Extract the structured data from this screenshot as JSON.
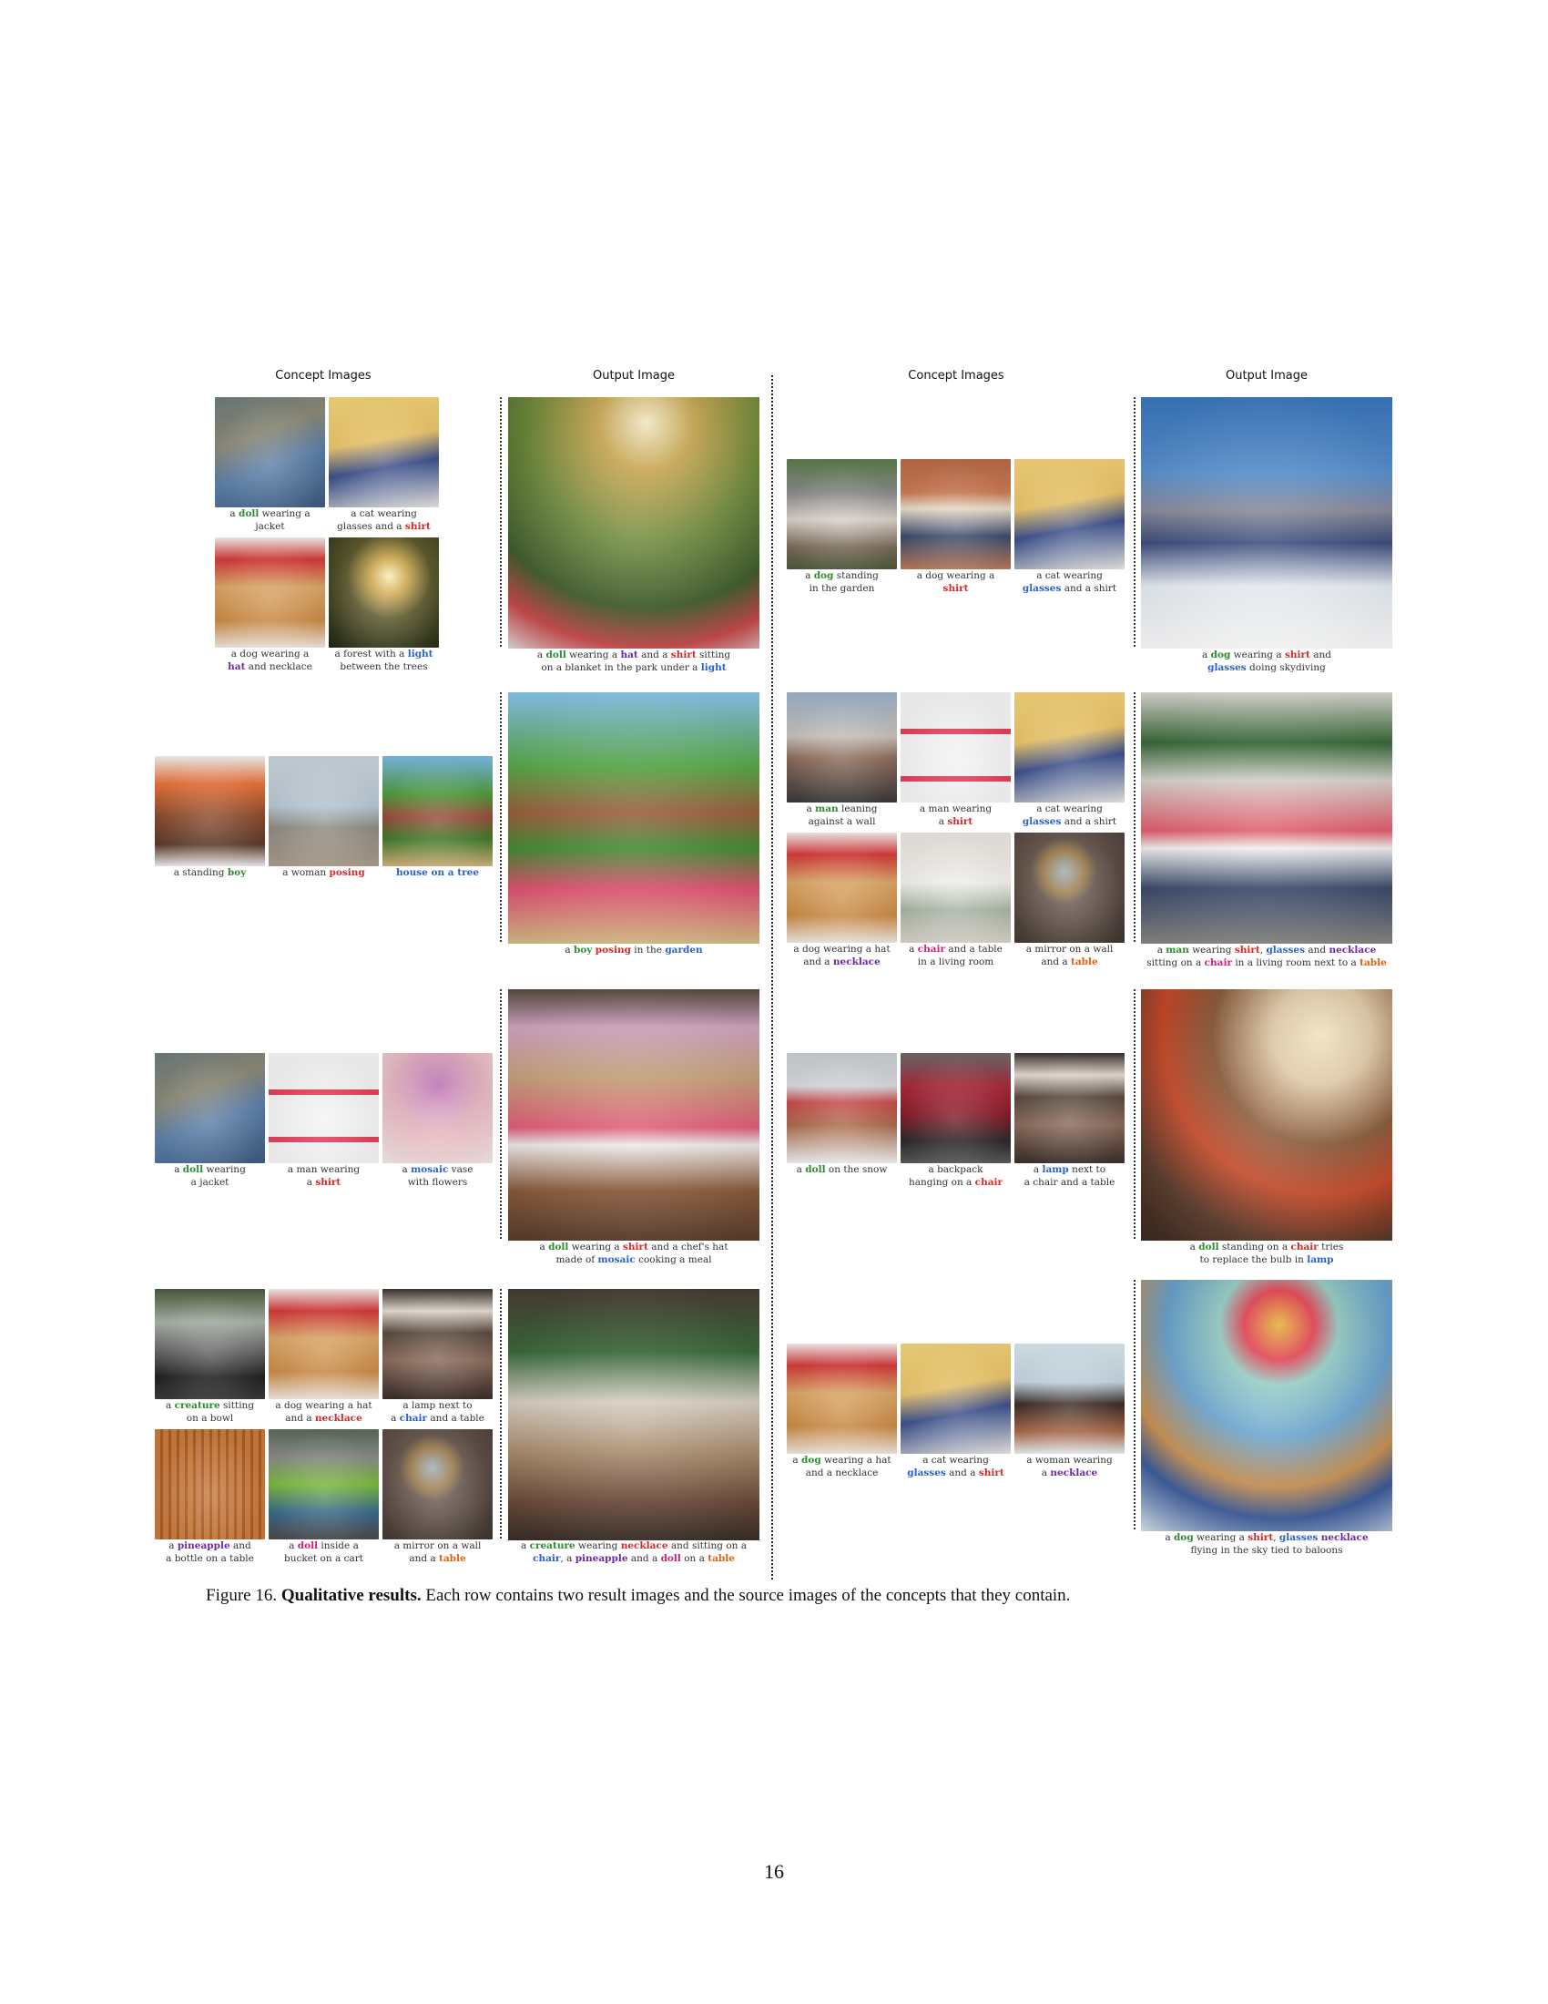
{
  "headers": {
    "concept": "Concept Images",
    "output": "Output Image"
  },
  "captions": {
    "l1a": [
      "a ",
      "doll",
      " wearing a",
      "jacket"
    ],
    "l1b": [
      "a cat wearing",
      "glasses and a ",
      "shirt"
    ],
    "l1c": [
      "a dog wearing a",
      "hat",
      " and necklace"
    ],
    "l1d": [
      "a forest with a ",
      "light",
      "between the trees"
    ],
    "l1out": [
      "a ",
      "doll",
      " wearing a ",
      "hat",
      " and a ",
      "shirt",
      " sitting",
      "on a blanket in the park under a ",
      "light"
    ],
    "l2a": [
      "a standing ",
      "boy"
    ],
    "l2b": [
      "a woman ",
      "posing"
    ],
    "l2c": [
      "house on a tree"
    ],
    "l2out": [
      "a ",
      "boy",
      " ",
      "posing",
      " in the ",
      "garden"
    ],
    "l3a": [
      "a ",
      "doll",
      " wearing",
      "a jacket"
    ],
    "l3b": [
      "a man wearing",
      "a ",
      "shirt"
    ],
    "l3c": [
      "a ",
      "mosaic",
      " vase",
      "with flowers"
    ],
    "l3out": [
      "a ",
      "doll",
      " wearing a ",
      "shirt",
      " and a chef's hat",
      "made of ",
      "mosaic",
      " cooking a meal"
    ],
    "l4a": [
      "a ",
      "creature",
      " sitting",
      "on a bowl"
    ],
    "l4b": [
      "a dog wearing a hat",
      "and a ",
      "necklace"
    ],
    "l4c": [
      "a lamp next to",
      "a ",
      "chair",
      " and a table"
    ],
    "l4d": [
      "a ",
      "pineapple",
      " and",
      "a bottle on a table"
    ],
    "l4e": [
      "a ",
      "doll",
      " inside a",
      "bucket on a cart"
    ],
    "l4f": [
      "a mirror on a wall",
      "and a ",
      "table"
    ],
    "l4out": [
      "a ",
      "creature",
      " wearing ",
      "necklace",
      " and sitting on a",
      "chair",
      ", a ",
      "pineapple",
      " and a ",
      "doll",
      " on a ",
      "table"
    ],
    "r1a": [
      "a ",
      "dog",
      " standing",
      "in the garden"
    ],
    "r1b": [
      "a dog wearing a",
      "shirt"
    ],
    "r1c": [
      "a cat wearing",
      "glasses",
      " and a shirt"
    ],
    "r1out": [
      "a ",
      "dog",
      " wearing a ",
      "shirt",
      " and",
      "glasses",
      " doing skydiving"
    ],
    "r2a": [
      "a ",
      "man",
      " leaning",
      "against a wall"
    ],
    "r2b": [
      "a man wearing",
      "a ",
      "shirt"
    ],
    "r2c": [
      "a cat wearing",
      "glasses",
      " and a shirt"
    ],
    "r2d": [
      "a dog wearing a hat",
      "and a ",
      "necklace"
    ],
    "r2e": [
      "a ",
      "chair",
      " and a table",
      "in a living room"
    ],
    "r2f": [
      "a mirror on a wall",
      "and a ",
      "table"
    ],
    "r2out": [
      "a ",
      "man",
      " wearing ",
      "shirt",
      ", ",
      "glasses",
      " and ",
      "necklace",
      "sitting on a ",
      "chair",
      " in a living room next to a ",
      "table"
    ],
    "r3a": [
      "a ",
      "doll",
      " on the snow"
    ],
    "r3b": [
      "a backpack",
      "hanging on a ",
      "chair"
    ],
    "r3c": [
      "a ",
      "lamp",
      " next to",
      "a chair and a table"
    ],
    "r3out": [
      "a ",
      "doll",
      " standing on a ",
      "chair",
      " tries",
      "to replace the bulb in ",
      "lamp"
    ],
    "r4a": [
      "a ",
      "dog",
      " wearing a hat",
      "and a necklace"
    ],
    "r4b": [
      "a cat wearing",
      "glasses",
      " and a ",
      "shirt"
    ],
    "r4c": [
      "a woman wearing",
      "a ",
      "necklace"
    ],
    "r4out": [
      "a ",
      "dog",
      " wearing a ",
      "shirt",
      ", ",
      "glasses",
      " ",
      "necklace",
      "flying in the sky tied to baloons"
    ]
  },
  "figure_caption": {
    "label": "Figure 16.",
    "title": "Qualitative results.",
    "text": "Each row contains two result images and the source images of the concepts that they contain."
  },
  "page_number": "16"
}
